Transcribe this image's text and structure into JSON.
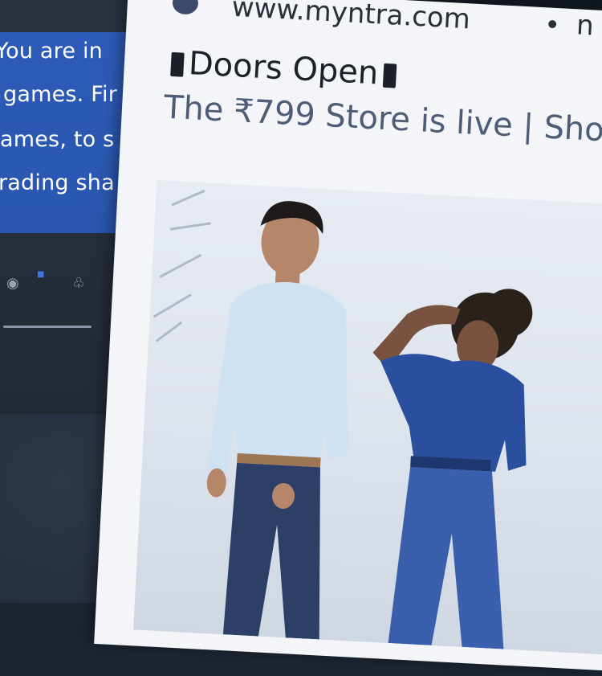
{
  "side_panel": {
    "lines": [
      "You are in",
      "games. Fir",
      "ames, to s",
      "rading sha"
    ],
    "icons": [
      "settings-icon",
      "bell-icon"
    ]
  },
  "notification": {
    "site_icon": "site-favicon-icon",
    "site": "www.myntra.com",
    "separator": "•",
    "site_more": "n",
    "headline": "Doors Open",
    "subline": "The ₹799 Store is live | Sho",
    "hero_image": "fashion-models-image"
  },
  "colors": {
    "panel_blue": "#2d5bb8",
    "card_bg": "#f3f5f8",
    "subline_text": "#4d5d78",
    "denim": "#2a4f9e"
  }
}
